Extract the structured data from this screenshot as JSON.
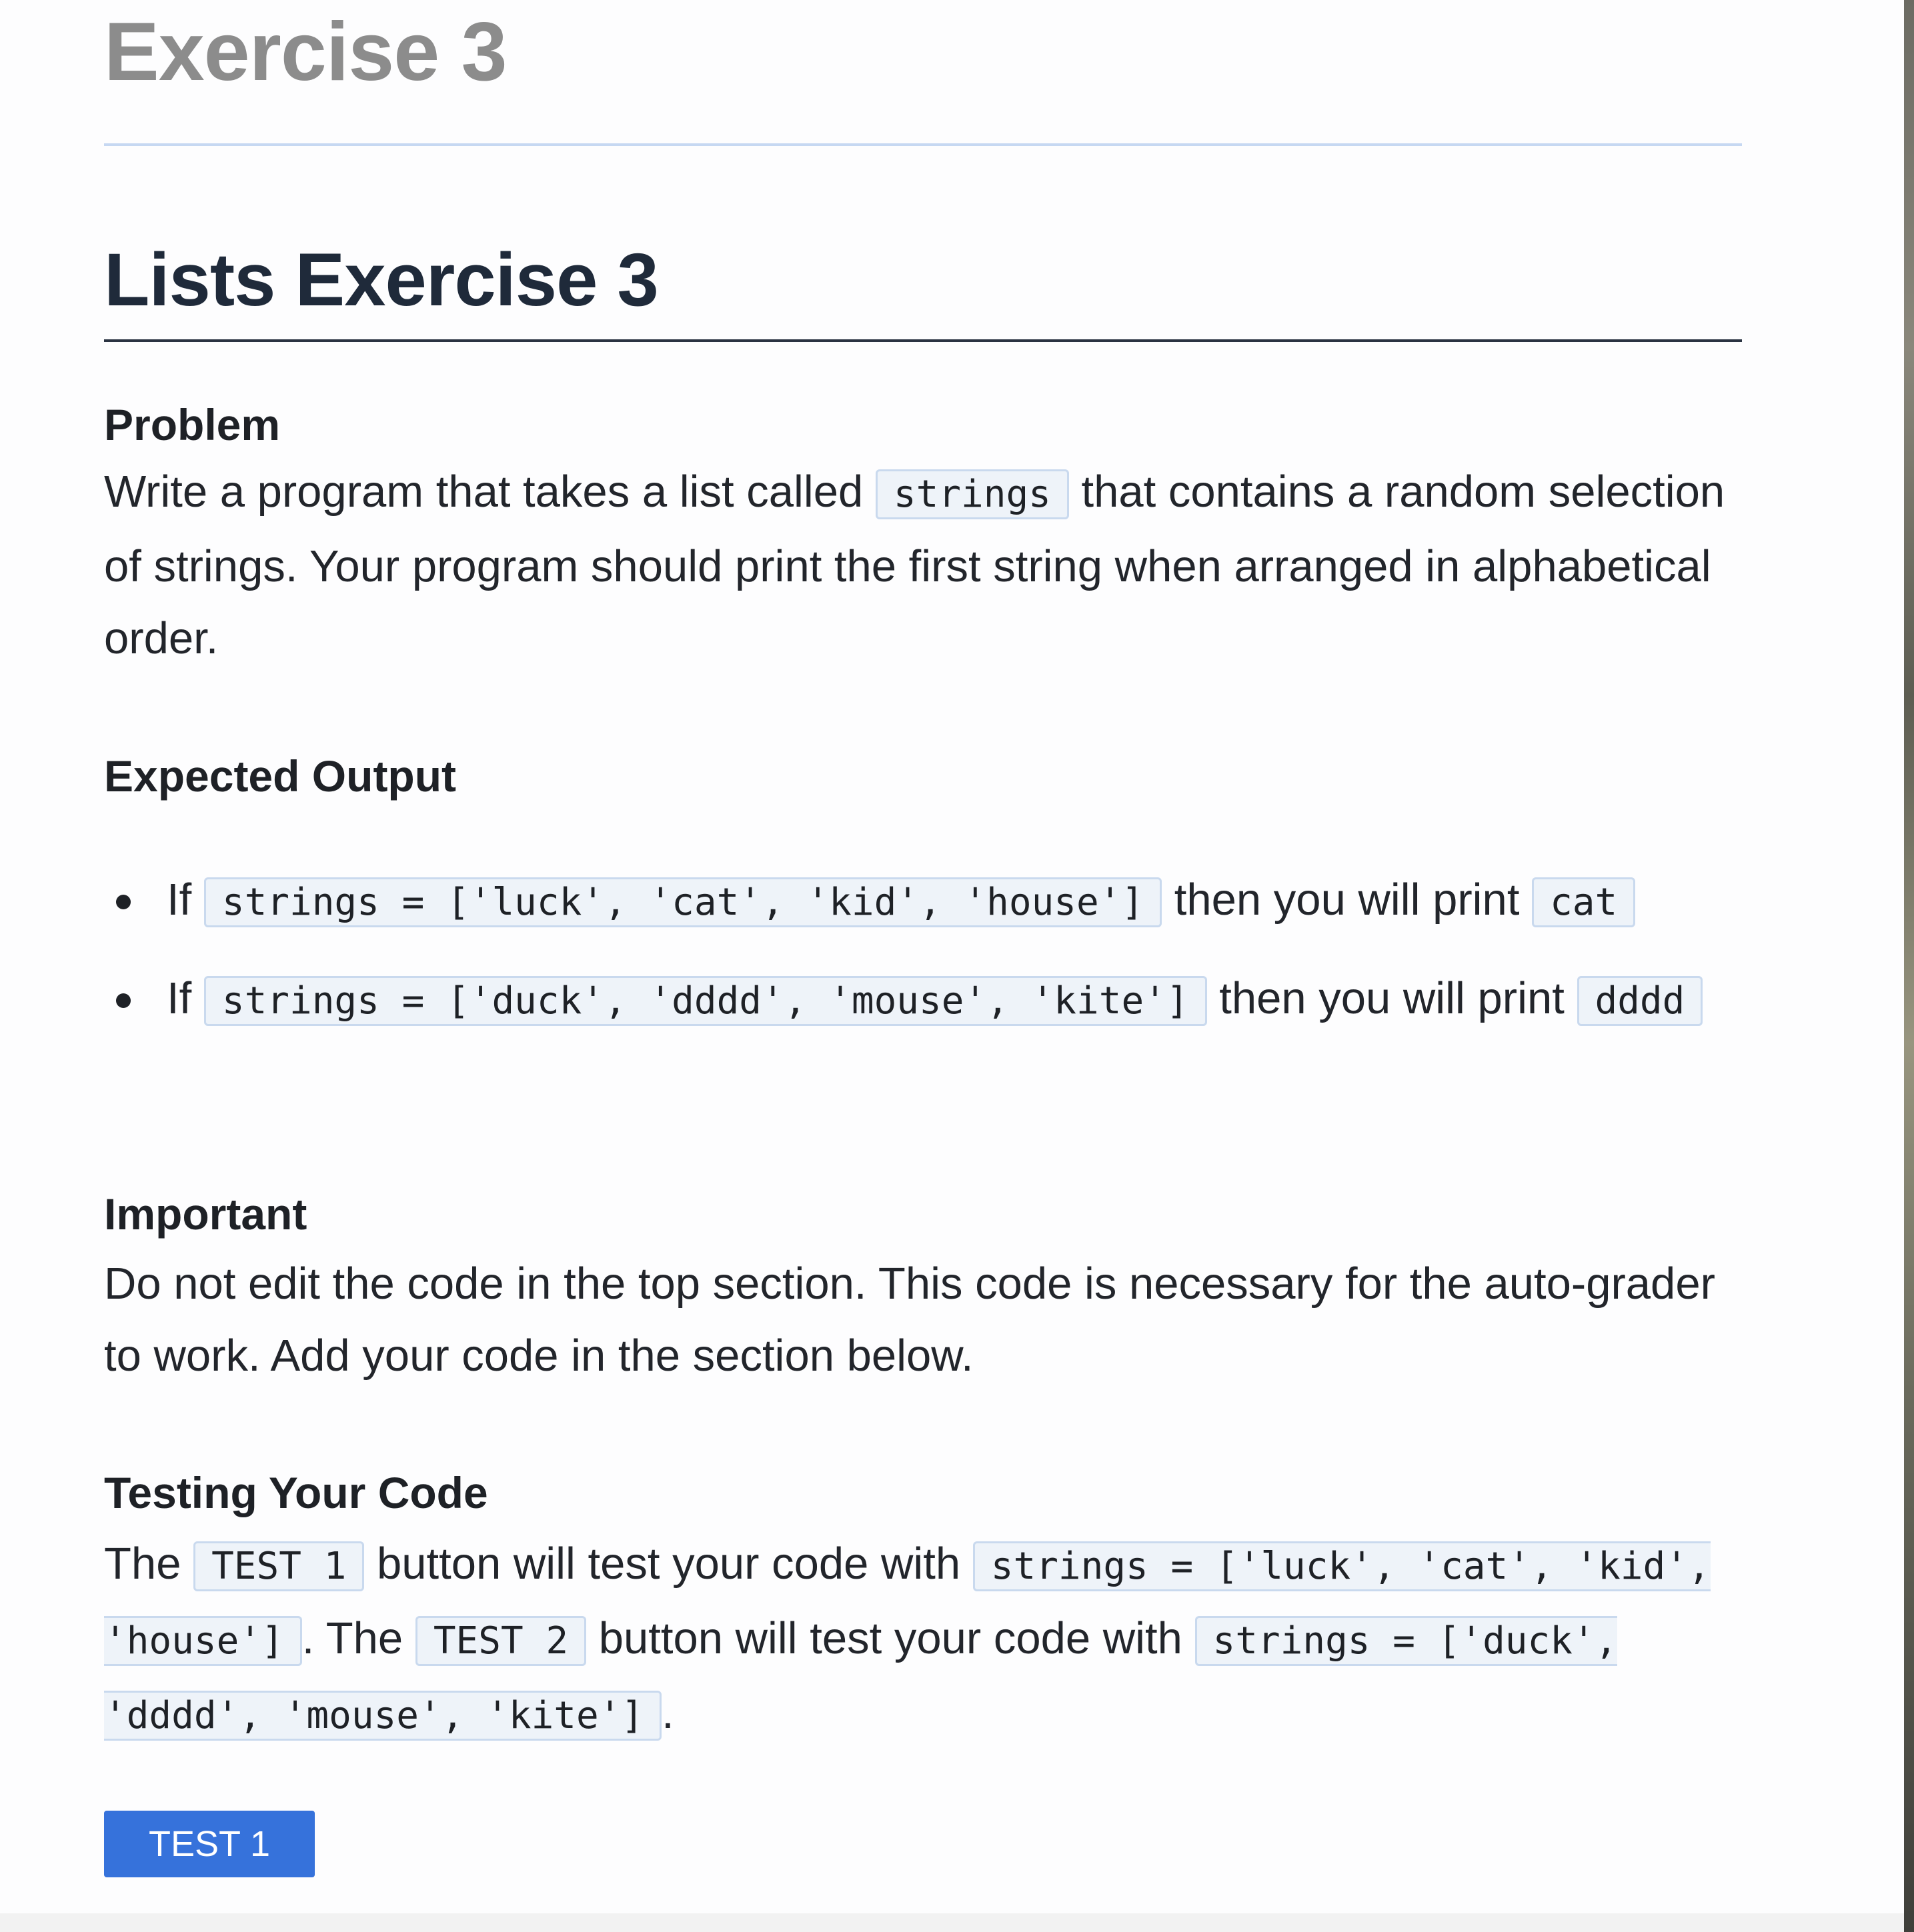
{
  "header": {
    "exercise_title": "Exercise 3",
    "lists_title": "Lists Exercise 3"
  },
  "problem": {
    "heading": "Problem",
    "text_before": "Write a program that takes a list called ",
    "code": "strings",
    "text_after": " that contains a random selection of strings. Your program should print the first string when arranged in alphabetical order."
  },
  "expected_output": {
    "heading": "Expected Output",
    "items": [
      {
        "prefix": "If ",
        "code_input": "strings = ['luck', 'cat', 'kid', 'house']",
        "middle": " then you will print ",
        "code_output": "cat"
      },
      {
        "prefix": "If ",
        "code_input": "strings = ['duck', 'dddd', 'mouse', 'kite']",
        "middle": " then you will print ",
        "code_output": "dddd"
      }
    ]
  },
  "important": {
    "heading": "Important",
    "text": "Do not edit the code in the top section. This code is necessary for the auto-grader to work. Add your code in the section below."
  },
  "testing": {
    "heading": "Testing Your Code",
    "t1": "The ",
    "code_test1": "TEST 1",
    "t2": " button will test your code with ",
    "code_input1": "strings = ['luck', 'cat', 'kid', 'house']",
    "t3": ". The ",
    "code_test2": "TEST 2",
    "t4": " button will test your code with ",
    "code_input2": "strings = ['duck', 'dddd', 'mouse', 'kite']",
    "t5": "."
  },
  "buttons": {
    "test1_label": "TEST 1"
  },
  "colors": {
    "accent": "#3672db",
    "code_background": "#eef3f9",
    "code_border": "#c9d9ee",
    "title_gray": "#8c8c8c",
    "heading_dark": "#1f2a3a"
  }
}
